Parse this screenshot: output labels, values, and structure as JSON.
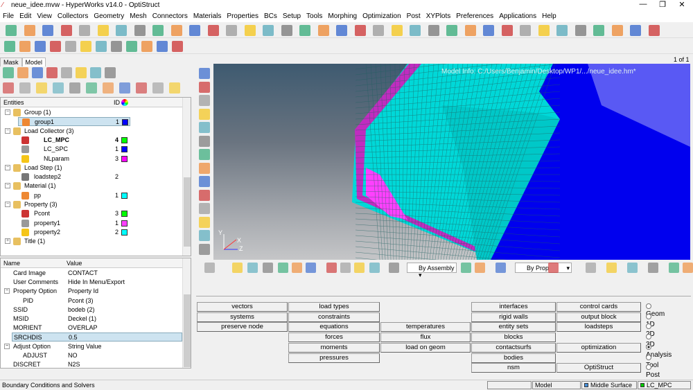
{
  "window": {
    "title": "neue_idee.mvw - HyperWorks v14.0 - OptiStruct",
    "minimize": "—",
    "maximize": "❐",
    "close": "✕"
  },
  "menu": [
    "File",
    "Edit",
    "View",
    "Collectors",
    "Geometry",
    "Mesh",
    "Connectors",
    "Materials",
    "Properties",
    "BCs",
    "Setup",
    "Tools",
    "Morphing",
    "Optimization",
    "Post",
    "XYPlots",
    "Preferences",
    "Applications",
    "Help"
  ],
  "left_tabs": [
    "Mask",
    "Model"
  ],
  "entities": {
    "header_name": "Entities",
    "header_id": "ID",
    "rows": [
      {
        "label": "Group (1)",
        "level": 0,
        "id": "",
        "color": ""
      },
      {
        "label": "group1",
        "level": 1,
        "id": "1",
        "color": "#0000ff",
        "selected": true
      },
      {
        "label": "Load Collector (3)",
        "level": 0,
        "id": "",
        "color": ""
      },
      {
        "label": "LC_MPC",
        "level": 1,
        "id": "4",
        "color": "#00ff00",
        "bold": true
      },
      {
        "label": "LC_SPC",
        "level": 1,
        "id": "1",
        "color": "#0000ff"
      },
      {
        "label": "NLparam",
        "level": 1,
        "id": "3",
        "color": "#ff00ff"
      },
      {
        "label": "Load Step (1)",
        "level": 0,
        "id": "",
        "color": ""
      },
      {
        "label": "loadstep2",
        "level": 1,
        "id": "2",
        "color": ""
      },
      {
        "label": "Material (1)",
        "level": 0,
        "id": "",
        "color": ""
      },
      {
        "label": "pp",
        "level": 1,
        "id": "1",
        "color": "#00ffff"
      },
      {
        "label": "Property (3)",
        "level": 0,
        "id": "",
        "color": ""
      },
      {
        "label": "Pcont",
        "level": 1,
        "id": "3",
        "color": "#00ff00"
      },
      {
        "label": "property1",
        "level": 1,
        "id": "1",
        "color": "#ff40ff"
      },
      {
        "label": "property2",
        "level": 1,
        "id": "2",
        "color": "#00ffff"
      },
      {
        "label": "Title (1)",
        "level": 0,
        "id": "",
        "color": "",
        "collapsed": true
      }
    ]
  },
  "properties": {
    "header_name": "Name",
    "header_value": "Value",
    "rows": [
      {
        "name": "Card Image",
        "value": "CONTACT",
        "indent": 1
      },
      {
        "name": "User Comments",
        "value": "Hide In Menu/Export",
        "indent": 1
      },
      {
        "name": "Property Option",
        "value": "Property Id",
        "indent": 0,
        "group": true
      },
      {
        "name": "PID",
        "value": "Pcont (3)",
        "indent": 2
      },
      {
        "name": "SSID",
        "value": "bodeb (2)",
        "indent": 1
      },
      {
        "name": "MSID",
        "value": "Deckel (1)",
        "indent": 1
      },
      {
        "name": "MORIENT",
        "value": "OVERLAP",
        "indent": 1
      },
      {
        "name": "SRCHDIS",
        "value": "0.5",
        "indent": 1,
        "selected": true
      },
      {
        "name": "Adjust Option",
        "value": "String Value",
        "indent": 0,
        "group": true
      },
      {
        "name": "ADJUST",
        "value": "NO",
        "indent": 2
      },
      {
        "name": "DISCRET",
        "value": "N2S",
        "indent": 1
      }
    ]
  },
  "viewport": {
    "page": "1 of 1",
    "model_info": "Model Info: C:/Users/Benjamin/Desktop/WP1/.../neue_idee.hm*",
    "axis_labels": [
      "X",
      "Y",
      "Z"
    ]
  },
  "view_toolbar": {
    "assembly_select": "By Assembly",
    "prop_select": "By Prop"
  },
  "panel": {
    "buttons": [
      [
        "vectors",
        "load types",
        "",
        "interfaces",
        "control cards"
      ],
      [
        "systems",
        "constraints",
        "",
        "rigid walls",
        "output block"
      ],
      [
        "preserve node",
        "equations",
        "temperatures",
        "entity sets",
        "loadsteps"
      ],
      [
        "",
        "forces",
        "flux",
        "blocks",
        ""
      ],
      [
        "",
        "moments",
        "load on geom",
        "contactsurfs",
        "optimization"
      ],
      [
        "",
        "pressures",
        "",
        "bodies",
        ""
      ],
      [
        "",
        "",
        "",
        "nsm",
        "OptiStruct"
      ]
    ],
    "radios": [
      "Geom",
      "1D",
      "2D",
      "3D",
      "Analysis",
      "Tool",
      "Post"
    ],
    "radio_selected": "Analysis"
  },
  "status": {
    "text": "Boundary Conditions and Solvers",
    "cells": [
      "",
      "Model",
      "Middle Surface",
      "LC_MPC"
    ],
    "cell_colors": [
      "",
      "",
      "#4a90d9",
      "#00cc00"
    ]
  }
}
